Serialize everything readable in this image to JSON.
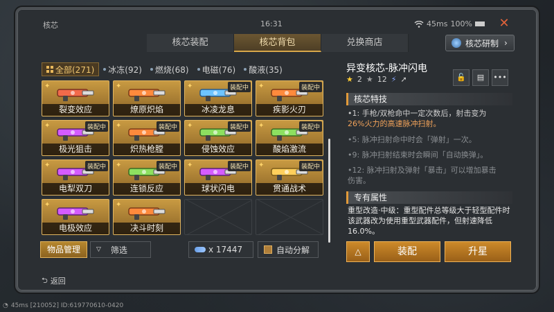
{
  "topbar": {
    "title": "核芯",
    "clock": "16:31",
    "ping": "45ms",
    "battery": "100%"
  },
  "tabs": [
    {
      "label": "核芯装配"
    },
    {
      "label": "核芯背包"
    },
    {
      "label": "兑换商店"
    }
  ],
  "research_button": "核芯研制",
  "filters": [
    {
      "label": "全部(271)"
    },
    {
      "label": "冰冻(92)"
    },
    {
      "label": "燃烧(68)"
    },
    {
      "label": "电磁(76)"
    },
    {
      "label": "酸液(35)"
    }
  ],
  "cards": [
    {
      "name": "裂变效应",
      "equipped": false
    },
    {
      "name": "燎原炽焰",
      "equipped": false
    },
    {
      "name": "冰凌龙息",
      "equipped": true,
      "badge": "装配中"
    },
    {
      "name": "疾影火刃",
      "equipped": true,
      "badge": "装配中"
    },
    {
      "name": "极光狙击",
      "equipped": true,
      "badge": "装配中"
    },
    {
      "name": "炽热枪膛",
      "equipped": true,
      "badge": "装配中"
    },
    {
      "name": "侵蚀效应",
      "equipped": true,
      "badge": "装配中"
    },
    {
      "name": "酸焰激流",
      "equipped": true,
      "badge": "装配中"
    },
    {
      "name": "电犁双刀",
      "equipped": true,
      "badge": "装配中"
    },
    {
      "name": "连锁反应",
      "equipped": true,
      "badge": "装配中"
    },
    {
      "name": "球状闪电",
      "equipped": true,
      "badge": "装配中"
    },
    {
      "name": "贯通战术",
      "equipped": true,
      "badge": "装配中"
    },
    {
      "name": "电极效应",
      "equipped": false
    },
    {
      "name": "决斗时刻",
      "equipped": false
    }
  ],
  "bottom": {
    "manage": "物品管理",
    "filter": "筛选",
    "count": "x 17447",
    "auto_decompose": "自动分解"
  },
  "detail": {
    "title": "异变核芯-脉冲闪电",
    "rank": {
      "stars": "2",
      "level": "12"
    },
    "skills_header": "核芯特技",
    "skill_lines": [
      {
        "text_a": "•1: 手枪/双枪命中一定次数后，射击变为",
        "text_b": "26%火力的高速脉冲扫射。",
        "dim": false
      },
      {
        "text_a": "•5: 脉冲扫射命中时会「弹射」一次。",
        "text_b": "",
        "dim": true
      },
      {
        "text_a": "•9: 脉冲扫射结束时会瞬间「自动换弹」。",
        "text_b": "",
        "dim": true
      },
      {
        "text_a": "•12: 脉冲扫射及弹射「暴击」可以增加暴击",
        "text_b": "伤害。",
        "dim": true
      }
    ],
    "attr_header": "专有属性",
    "attr_text": "重型改造·中级：重型配件总等级大于轻型配件时该武器改为使用重型武器配件，但射速降低16.0%。",
    "equip": "装配",
    "upgrade": "升星"
  },
  "back": "返回",
  "status": "45ms  [210052] ID:619770610-0420"
}
